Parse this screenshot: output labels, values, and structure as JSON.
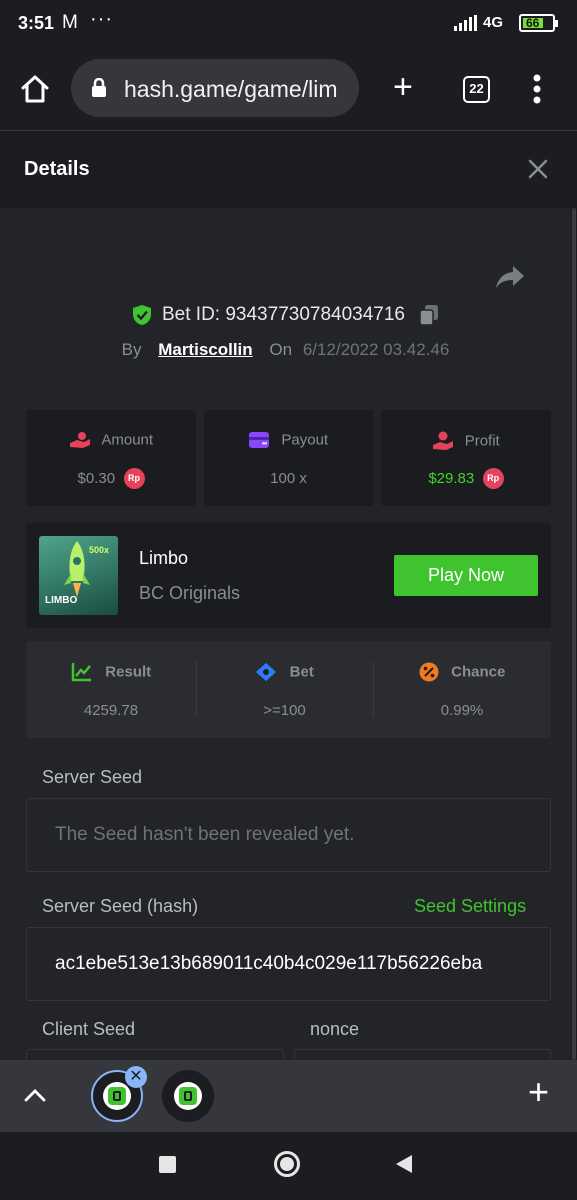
{
  "status": {
    "time": "3:51",
    "network": "4G",
    "battery": "66"
  },
  "browser": {
    "url": "hash.game/game/lim",
    "tab_count": "22"
  },
  "details": {
    "title": "Details"
  },
  "bet": {
    "id_label": "Bet ID: 93437730784034716",
    "by_label": "By",
    "user": "Martiscollin",
    "on_label": "On",
    "datetime": "6/12/2022 03.42.46"
  },
  "stats": [
    {
      "label": "Amount",
      "value": "$0.30",
      "currency": "Rp"
    },
    {
      "label": "Payout",
      "value": "100 x"
    },
    {
      "label": "Profit",
      "value": "$29.83",
      "currency": "Rp"
    }
  ],
  "game": {
    "name": "Limbo",
    "provider": "BC Originals",
    "thumb_badge": "500x",
    "thumb_text": "LIMBO",
    "play_label": "Play Now"
  },
  "result": [
    {
      "label": "Result",
      "value": "4259.78"
    },
    {
      "label": "Bet",
      "value": ">=100"
    },
    {
      "label": "Chance",
      "value": "0.99%"
    }
  ],
  "seeds": {
    "server_seed_label": "Server Seed",
    "server_seed_value": "The Seed hasn't been revealed yet.",
    "server_hash_label": "Server Seed (hash)",
    "seed_settings_label": "Seed Settings",
    "server_hash_value": "ac1ebe513e13b689011c40b4c029e117b56226eba",
    "client_seed_label": "Client Seed",
    "nonce_label": "nonce"
  },
  "colors": {
    "accent_green": "#3fc42f",
    "profit_green": "#3fd42a",
    "rp_red": "#e6425c",
    "bg": "#232428",
    "card": "#1b1c20"
  }
}
